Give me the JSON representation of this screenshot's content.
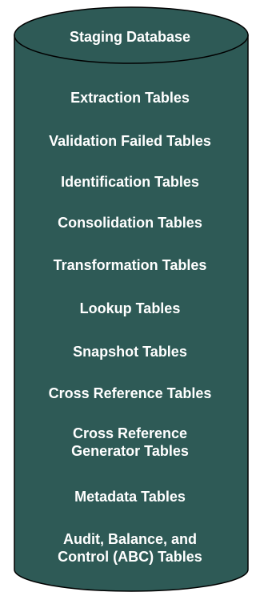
{
  "database": {
    "title": "Staging Database",
    "fill_color": "#2e5a56",
    "stroke_color": "#000000",
    "text_color": "#ffffff",
    "tables": [
      {
        "line1": "Extraction Tables",
        "line2": ""
      },
      {
        "line1": "Validation Failed Tables",
        "line2": ""
      },
      {
        "line1": "Identification Tables",
        "line2": ""
      },
      {
        "line1": "Consolidation Tables",
        "line2": ""
      },
      {
        "line1": "Transformation Tables",
        "line2": ""
      },
      {
        "line1": "Lookup Tables",
        "line2": ""
      },
      {
        "line1": "Snapshot Tables",
        "line2": ""
      },
      {
        "line1": "Cross Reference Tables",
        "line2": ""
      },
      {
        "line1": "Cross Reference",
        "line2": "Generator Tables"
      },
      {
        "line1": "Metadata Tables",
        "line2": ""
      },
      {
        "line1": "Audit, Balance, and",
        "line2": "Control (ABC) Tables"
      }
    ]
  }
}
